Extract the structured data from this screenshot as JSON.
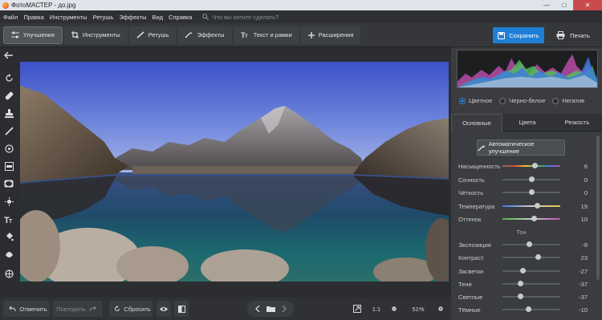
{
  "window": {
    "title": "ФотоМАСТЕР - до.jpg"
  },
  "menu": {
    "items": [
      "Файл",
      "Правка",
      "Инструменты",
      "Ретушь",
      "Эффекты",
      "Вид",
      "Справка"
    ],
    "search_placeholder": "Что вы хотите сделать?"
  },
  "toolbar": {
    "tabs": [
      "Улучшения",
      "Инструменты",
      "Ретушь",
      "Эффекты",
      "Текст и рамки",
      "Расширения"
    ],
    "active_tab": "Улучшения",
    "save_label": "Сохранить",
    "print_label": "Печать"
  },
  "bottom": {
    "undo_label": "Отменить",
    "redo_label": "Повторить",
    "reset_label": "Сбросить",
    "ratio_label": "1:1",
    "zoom_label": "51%"
  },
  "panel": {
    "modes": [
      "Цветное",
      "Черно-белое",
      "Негатив"
    ],
    "selected_mode": "Цветное",
    "tabs": [
      "Основные",
      "Цвета",
      "Резкость"
    ],
    "active_tab": "Основные",
    "auto_label": "Автоматическое улучшение",
    "tone_section": "Тон",
    "sliders": [
      {
        "label": "Насыщенность",
        "value": "6",
        "pos": 0.56,
        "grad": "sat"
      },
      {
        "label": "Сочность",
        "value": "0",
        "pos": 0.5,
        "grad": "none"
      },
      {
        "label": "Чёткость",
        "value": "0",
        "pos": 0.5,
        "grad": "none"
      },
      {
        "label": "Температура",
        "value": "19",
        "pos": 0.6,
        "grad": "temp"
      },
      {
        "label": "Оттенок",
        "value": "10",
        "pos": 0.55,
        "grad": "tint"
      },
      {
        "label": "Экспозиция",
        "value": "-8",
        "pos": 0.46,
        "grad": "none"
      },
      {
        "label": "Контраст",
        "value": "23",
        "pos": 0.62,
        "grad": "none"
      },
      {
        "label": "Засветки",
        "value": "-27",
        "pos": 0.36,
        "grad": "none"
      },
      {
        "label": "Тени",
        "value": "-37",
        "pos": 0.31,
        "grad": "none"
      },
      {
        "label": "Светлые",
        "value": "-37",
        "pos": 0.31,
        "grad": "none"
      },
      {
        "label": "Тёмные",
        "value": "-10",
        "pos": 0.45,
        "grad": "none"
      }
    ]
  },
  "colors": {
    "accent": "#1f7fd6",
    "panel_bg": "#3a3c40",
    "app_bg": "#2b2d30"
  }
}
